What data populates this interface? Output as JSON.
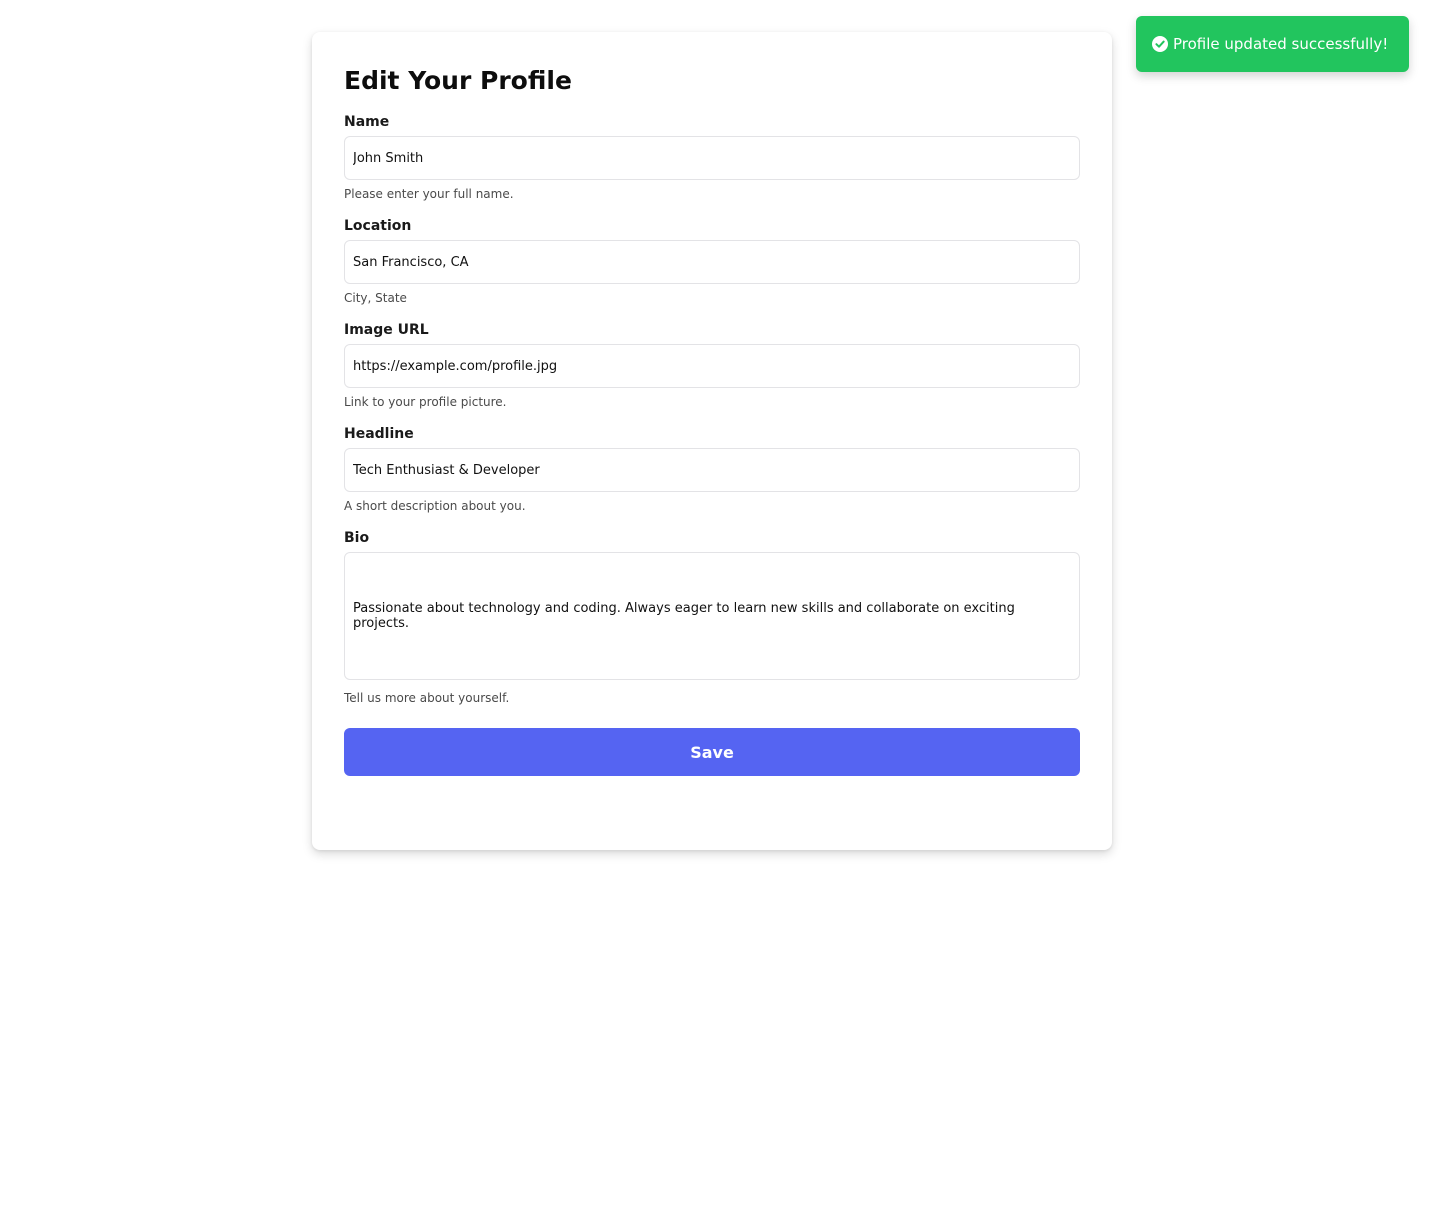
{
  "toast": {
    "message": "Profile updated successfully!",
    "icon": "check-circle-icon",
    "color": "#22c55e"
  },
  "form": {
    "title": "Edit Your Profile",
    "fields": {
      "name": {
        "label": "Name",
        "value": "John Smith",
        "help": "Please enter your full name."
      },
      "location": {
        "label": "Location",
        "value": "San Francisco, CA",
        "help": "City, State"
      },
      "image_url": {
        "label": "Image URL",
        "value": "https://example.com/profile.jpg",
        "help": "Link to your profile picture."
      },
      "headline": {
        "label": "Headline",
        "value": "Tech Enthusiast & Developer",
        "help": "A short description about you."
      },
      "bio": {
        "label": "Bio",
        "value": "Passionate about technology and coding. Always eager to learn new skills and collaborate on exciting projects.",
        "help": "Tell us more about yourself."
      }
    },
    "save_label": "Save",
    "accent_color": "#5564f2"
  }
}
